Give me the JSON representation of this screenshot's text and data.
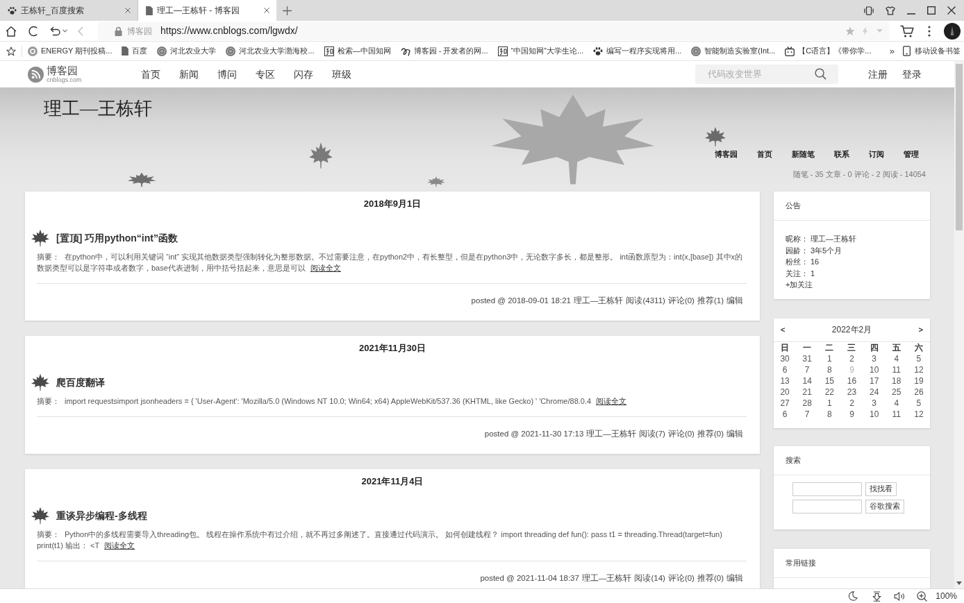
{
  "browser": {
    "tabs": [
      {
        "title": "王栋轩_百度搜索",
        "kind": "paw",
        "selected": false
      },
      {
        "title": "理工—王栋轩 - 博客园",
        "kind": "page",
        "selected": true
      }
    ],
    "address": {
      "site": "博客园",
      "url": "https://www.cnblogs.com/lgwdx/"
    },
    "bookmarks": [
      {
        "label": "ENERGY 期刊投稿...",
        "kind": "badge"
      },
      {
        "label": "百度",
        "kind": "page"
      },
      {
        "label": "河北农业大学",
        "kind": "seal"
      },
      {
        "label": "河北农业大学渤海校...",
        "kind": "seal"
      },
      {
        "label": "检索—中国知网",
        "kind": "tile"
      },
      {
        "label": "博客园 - 开发者的网...",
        "kind": "swirl"
      },
      {
        "label": "“中国知网”大学生论...",
        "kind": "tile"
      },
      {
        "label": "编写一程序实现将用...",
        "kind": "paw"
      },
      {
        "label": "智能制造实验室(Int...",
        "kind": "seal"
      },
      {
        "label": "【C语言】《带你学...",
        "kind": "tv"
      }
    ],
    "more_bookmarks": "»",
    "mobile_bookmarks": "移动设备书签"
  },
  "site_nav": {
    "logo": "博客园",
    "logo_domain": "cnblogs.com",
    "links": [
      "首页",
      "新闻",
      "博问",
      "专区",
      "闪存",
      "班级"
    ],
    "search": {
      "placeholder": "代码改变世界"
    },
    "account_links": [
      "注册",
      "登录"
    ]
  },
  "blog_header": {
    "title": "理工—王栋轩",
    "nav": [
      "博客园",
      "首页",
      "新随笔",
      "联系",
      "订阅",
      "管理"
    ],
    "stats": "随笔 - 35 文章 - 0 评论 - 2 阅读 - 14054"
  },
  "posts": [
    {
      "date": "2018年9月1日",
      "title": "[置顶] 巧用python“int”函数",
      "summary_label": "摘要：",
      "summary": "在python中，可以利用关键词 “int” 实现其他数据类型强制转化为整形数据。不过需要注意，在python2中，有长整型，但是在python3中，无论数字多长，都是整形。 int函数原型为：int(x,[base]) 其中x的数据类型可以是字符串或者数字，base代表进制，用中括号括起来，意思是可以",
      "read_more": "阅读全文",
      "posted": "posted @ 2018-09-01 18:21",
      "footer_links": [
        "理工—王栋轩",
        "阅读(4311)",
        "评论(0)",
        "推荐(1)",
        "编辑"
      ]
    },
    {
      "date": "2021年11月30日",
      "title": "爬百度翻译",
      "summary_label": "摘要：",
      "summary": "import requestsimport jsonheaders = { 'User-Agent': 'Mozilla/5.0 (Windows NT 10.0; Win64; x64) AppleWebKit/537.36 (KHTML, like Gecko) ' 'Chrome/88.0.4",
      "read_more": "阅读全文",
      "posted": "posted @ 2021-11-30 17:13",
      "footer_links": [
        "理工—王栋轩",
        "阅读(7)",
        "评论(0)",
        "推荐(0)",
        "编辑"
      ]
    },
    {
      "date": "2021年11月4日",
      "title": "重谈异步编程-多线程",
      "summary_label": "摘要：",
      "summary": "Python中的多线程需要导入threading包。 线程在操作系统中有过介绍，就不再过多阐述了。直接通过代码演示。 如何创建线程？ import threading def fun(): pass t1 = threading.Thread(target=fun) print(t1) 输出： <T",
      "read_more": "阅读全文",
      "posted": "posted @ 2021-11-04 18:37",
      "footer_links": [
        "理工—王栋轩",
        "阅读(14)",
        "评论(0)",
        "推荐(0)",
        "编辑"
      ]
    }
  ],
  "sidebar": {
    "notice": {
      "title": "公告",
      "rows": [
        {
          "label": "昵称：",
          "value": "理工—王栋轩"
        },
        {
          "label": "园龄：",
          "value": "3年5个月"
        },
        {
          "label": "粉丝：",
          "value": "16"
        },
        {
          "label": "关注：",
          "value": "1"
        }
      ],
      "follow": "+加关注"
    },
    "calendar": {
      "prev": "<",
      "month": "2022年2月",
      "next": ">",
      "weekdays": [
        "日",
        "一",
        "二",
        "三",
        "四",
        "五",
        "六"
      ],
      "weeks": [
        [
          {
            "day": "30",
            "faded": false
          },
          {
            "day": "31",
            "faded": false
          },
          {
            "day": "1",
            "faded": false
          },
          {
            "day": "2",
            "faded": false
          },
          {
            "day": "3",
            "faded": false
          },
          {
            "day": "4",
            "faded": false
          },
          {
            "day": "5",
            "faded": false
          }
        ],
        [
          {
            "day": "6",
            "faded": false
          },
          {
            "day": "7",
            "faded": false
          },
          {
            "day": "8",
            "faded": false
          },
          {
            "day": "9",
            "faded": true
          },
          {
            "day": "10",
            "faded": false
          },
          {
            "day": "11",
            "faded": false
          },
          {
            "day": "12",
            "faded": false
          }
        ],
        [
          {
            "day": "13",
            "faded": false
          },
          {
            "day": "14",
            "faded": false
          },
          {
            "day": "15",
            "faded": false
          },
          {
            "day": "16",
            "faded": false
          },
          {
            "day": "17",
            "faded": false
          },
          {
            "day": "18",
            "faded": false
          },
          {
            "day": "19",
            "faded": false
          }
        ],
        [
          {
            "day": "20",
            "faded": false
          },
          {
            "day": "21",
            "faded": false
          },
          {
            "day": "22",
            "faded": false
          },
          {
            "day": "23",
            "faded": false
          },
          {
            "day": "24",
            "faded": false
          },
          {
            "day": "25",
            "faded": false
          },
          {
            "day": "26",
            "faded": false
          }
        ],
        [
          {
            "day": "27",
            "faded": false
          },
          {
            "day": "28",
            "faded": false
          },
          {
            "day": "1",
            "faded": false
          },
          {
            "day": "2",
            "faded": false
          },
          {
            "day": "3",
            "faded": false
          },
          {
            "day": "4",
            "faded": false
          },
          {
            "day": "5",
            "faded": false
          }
        ],
        [
          {
            "day": "6",
            "faded": false
          },
          {
            "day": "7",
            "faded": false
          },
          {
            "day": "8",
            "faded": false
          },
          {
            "day": "9",
            "faded": false
          },
          {
            "day": "10",
            "faded": false
          },
          {
            "day": "11",
            "faded": false
          },
          {
            "day": "12",
            "faded": false
          }
        ]
      ]
    },
    "search": {
      "title": "搜索",
      "forms": [
        {
          "button": "找找看"
        },
        {
          "button": "谷歌搜索"
        }
      ]
    },
    "links": {
      "title": "常用链接"
    }
  },
  "status_bar": {
    "zoom": "100%"
  }
}
